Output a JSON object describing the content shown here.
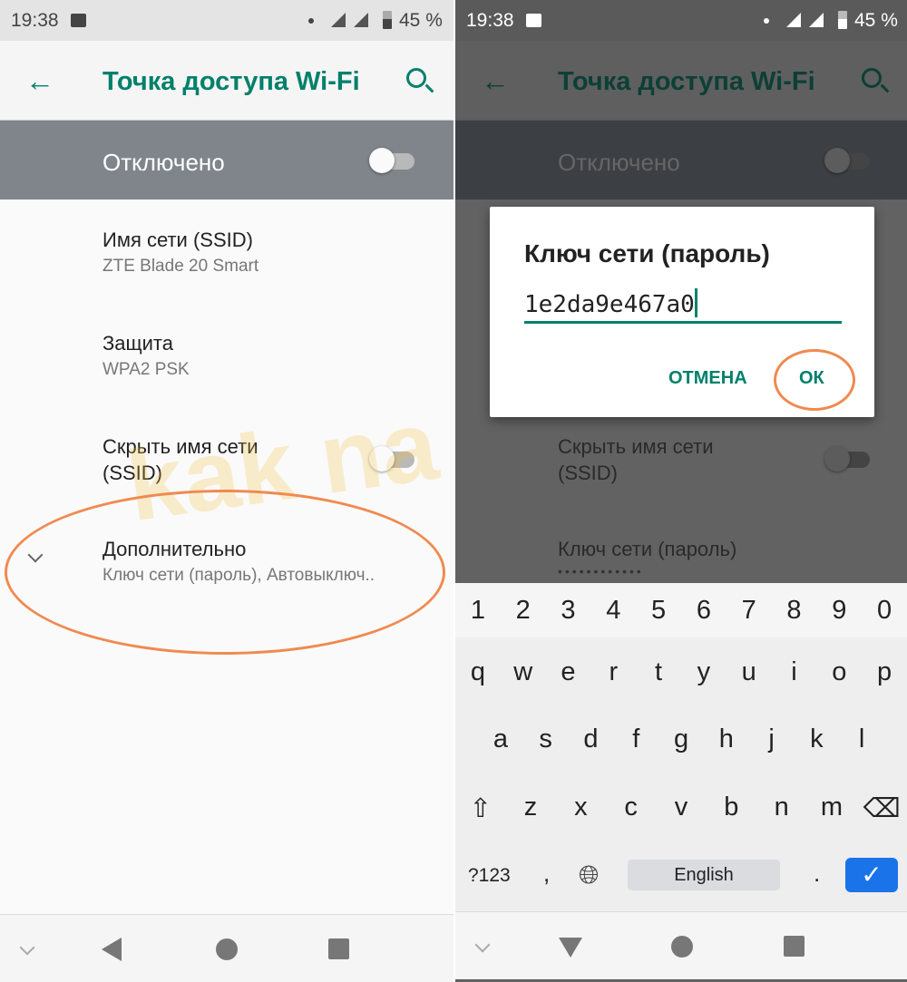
{
  "status": {
    "time": "19:38",
    "battery": "45 %"
  },
  "appbar": {
    "title": "Точка доступа Wi-Fi",
    "back_icon": "arrow-left-icon",
    "search_icon": "search-icon"
  },
  "hotspot": {
    "label": "Отключено",
    "enabled": false
  },
  "settings": {
    "ssid": {
      "title": "Имя сети (SSID)",
      "value": "ZTE Blade 20 Smart"
    },
    "security": {
      "title": "Защита",
      "value": "WPA2 PSK"
    },
    "hide_ssid": {
      "title_line1": "Скрыть имя сети",
      "title_line2": "(SSID)",
      "enabled": false
    },
    "advanced": {
      "title": "Дополнительно",
      "summary": "Ключ сети (пароль), Автовыключ.."
    },
    "password": {
      "title": "Ключ сети (пароль)",
      "masked": "••••••••••••"
    }
  },
  "dialog": {
    "title": "Ключ сети (пароль)",
    "value": "1e2da9e467a0",
    "cancel": "ОТМЕНА",
    "ok": "ОК"
  },
  "keyboard": {
    "numbers": [
      "1",
      "2",
      "3",
      "4",
      "5",
      "6",
      "7",
      "8",
      "9",
      "0"
    ],
    "row1": [
      "q",
      "w",
      "e",
      "r",
      "t",
      "y",
      "u",
      "i",
      "o",
      "p"
    ],
    "row2": [
      "a",
      "s",
      "d",
      "f",
      "g",
      "h",
      "j",
      "k",
      "l"
    ],
    "row3": [
      "z",
      "x",
      "c",
      "v",
      "b",
      "n",
      "m"
    ],
    "symbols": "?123",
    "comma": ",",
    "space": "English",
    "period": ".",
    "shift_icon": "shift-icon",
    "backspace_icon": "backspace-icon",
    "globe_icon": "globe-icon",
    "enter_icon": "check-icon"
  },
  "watermark": "kak na android",
  "colors": {
    "accent": "#00806a",
    "highlight": "#f08a50"
  }
}
